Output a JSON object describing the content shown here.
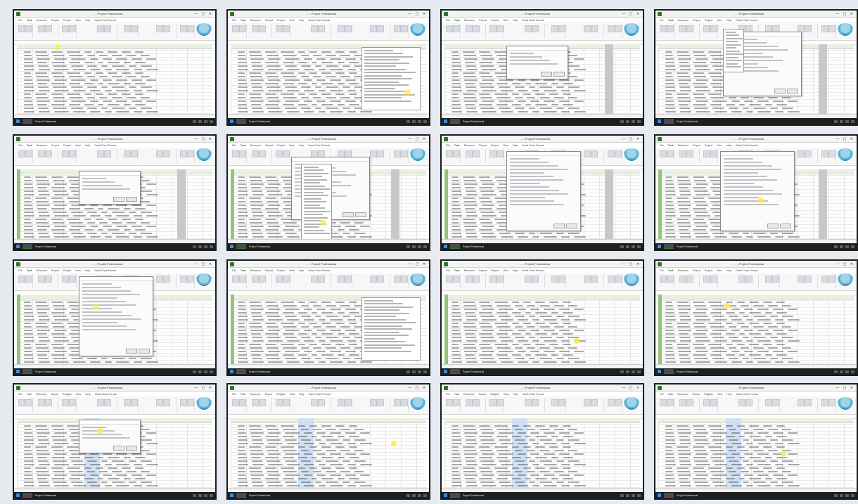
{
  "sheet": {
    "background": "#e6eaf1",
    "border_color": "#1c1c1c",
    "accent_green": "#31752f",
    "column_green": "#92c47a",
    "cursor_highlight": "#ffec3d"
  },
  "window": {
    "title": "… - Project Professional",
    "controls": "— ▢ ✕"
  },
  "ribbon_tabs": [
    "File",
    "Task",
    "Resource",
    "Report",
    "Project",
    "View",
    "Help",
    "Gantt Chart Format"
  ],
  "taskbar": {
    "app_label": "Project Professional",
    "icons": [
      "windows-logo-icon",
      "project-app-icon"
    ]
  },
  "thumbnails": [
    {
      "index": 1,
      "active_tab": "Task",
      "dialog": "none"
    },
    {
      "index": 2,
      "active_tab": "Task",
      "dialog": "field-dropdown"
    },
    {
      "index": 3,
      "active_tab": "Task",
      "dialog": "small-dialog"
    },
    {
      "index": 4,
      "active_tab": "Task",
      "dialog": "filter-dialog"
    },
    {
      "index": 5,
      "active_tab": "Task",
      "dialog": "small-dialog"
    },
    {
      "index": 6,
      "active_tab": "Task",
      "dialog": "dialog-with-list"
    },
    {
      "index": 7,
      "active_tab": "Task",
      "dialog": "wide-dialog"
    },
    {
      "index": 8,
      "active_tab": "Task",
      "dialog": "wide-dialog"
    },
    {
      "index": 9,
      "active_tab": "Task",
      "dialog": "wide-dialog"
    },
    {
      "index": 10,
      "active_tab": "Task",
      "dialog": "field-dropdown"
    },
    {
      "index": 11,
      "active_tab": "Task",
      "dialog": "none"
    },
    {
      "index": 12,
      "active_tab": "Task",
      "dialog": "none"
    },
    {
      "index": 13,
      "active_tab": "Project",
      "dialog": "small-dialog"
    },
    {
      "index": 14,
      "active_tab": "Project",
      "dialog": "none"
    },
    {
      "index": 15,
      "active_tab": "Project",
      "dialog": "none"
    },
    {
      "index": 16,
      "active_tab": "Project",
      "dialog": "none"
    }
  ]
}
